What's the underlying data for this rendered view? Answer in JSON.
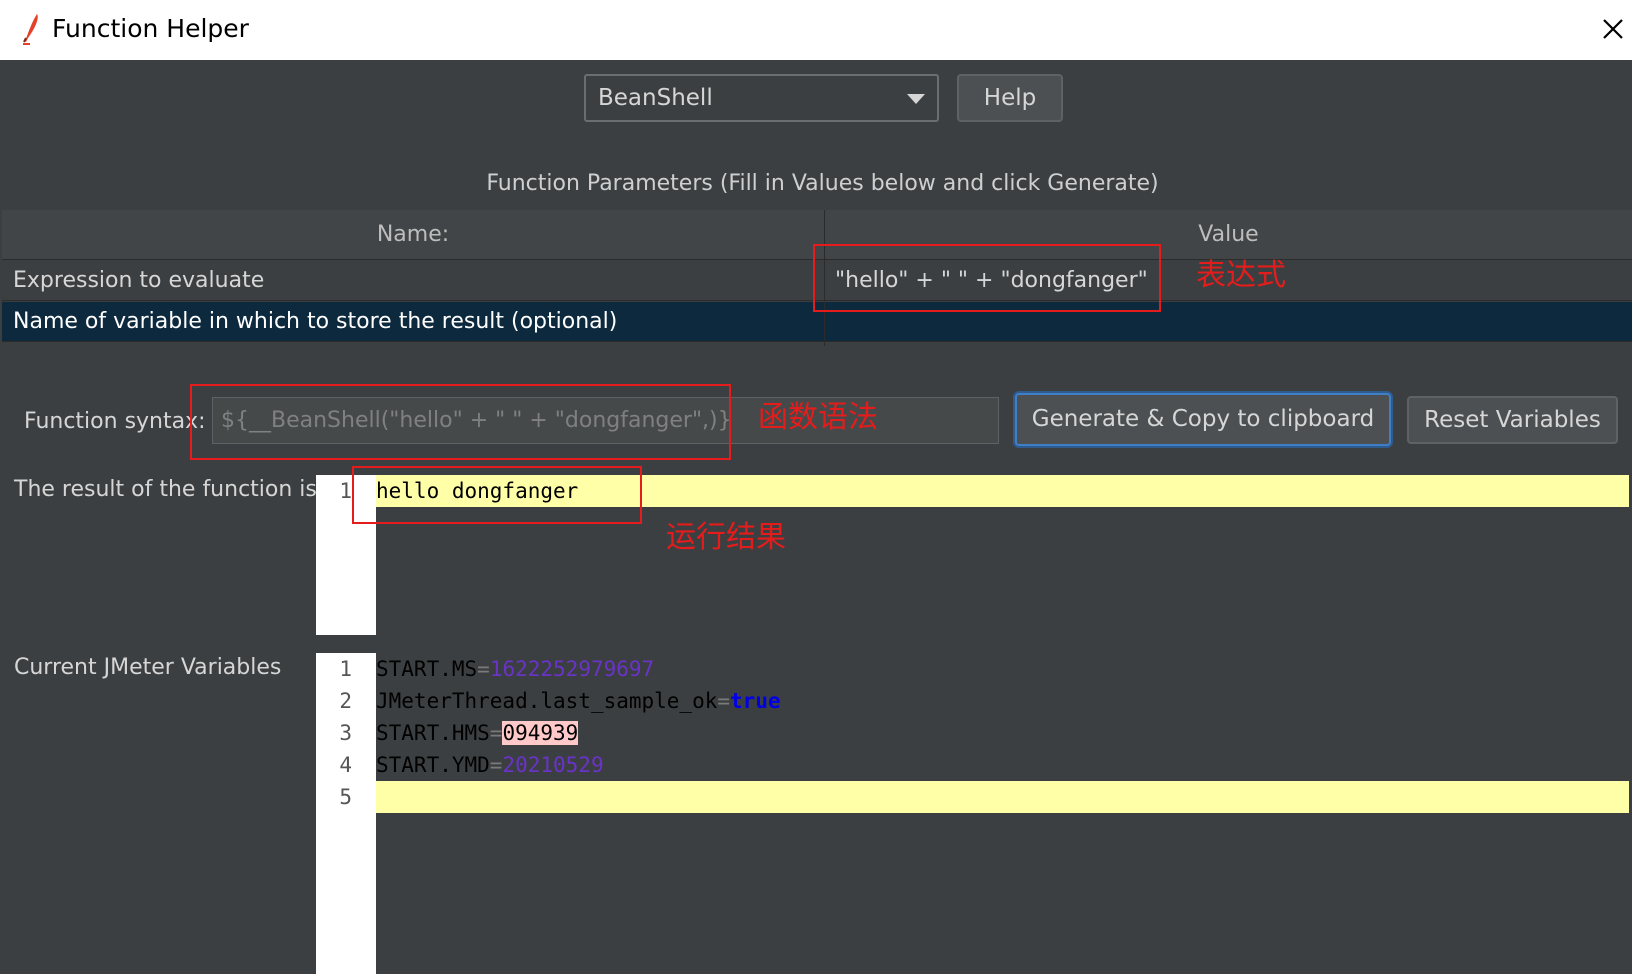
{
  "window": {
    "title": "Function Helper",
    "close_icon": "close-icon",
    "app_icon": "feather-icon"
  },
  "toolbar": {
    "function_select_value": "BeanShell",
    "help_label": "Help"
  },
  "params": {
    "caption": "Function Parameters (Fill in Values below and click Generate)",
    "headers": {
      "name": "Name:",
      "value": "Value"
    },
    "rows": [
      {
        "name": "Expression to evaluate",
        "value": "\"hello\" + \" \" + \"dongfanger\""
      },
      {
        "name": "Name of variable in which to store the result (optional)",
        "value": ""
      }
    ]
  },
  "syntax": {
    "label": "Function syntax:",
    "value": "${__BeanShell(\"hello\" + \" \" + \"dongfanger\",)}",
    "generate_label": "Generate & Copy to clipboard",
    "reset_label": "Reset Variables"
  },
  "result": {
    "label": "The result of the function is",
    "line_numbers": [
      "1"
    ],
    "text": "hello dongfanger"
  },
  "variables": {
    "label": "Current JMeter Variables",
    "line_numbers": [
      "1",
      "2",
      "3",
      "4",
      "5"
    ],
    "lines": [
      {
        "key": "START.MS",
        "eq": "=",
        "value": "1622252979697"
      },
      {
        "key": "JMeterThread.last_sample_ok",
        "eq": "=",
        "value": "true"
      },
      {
        "key": "START.HMS",
        "eq": "=",
        "value": "094939"
      },
      {
        "key": "START.YMD",
        "eq": "=",
        "value": "20210529"
      }
    ]
  },
  "annotations": {
    "expression": "表达式",
    "syntax": "函数语法",
    "result": "运行结果",
    "color": "#e51c1c"
  },
  "colors": {
    "background": "#3c3f41",
    "selected_row": "#0d293e",
    "focus_border": "#3e7fc6",
    "line_highlight": "#ffffa8"
  }
}
